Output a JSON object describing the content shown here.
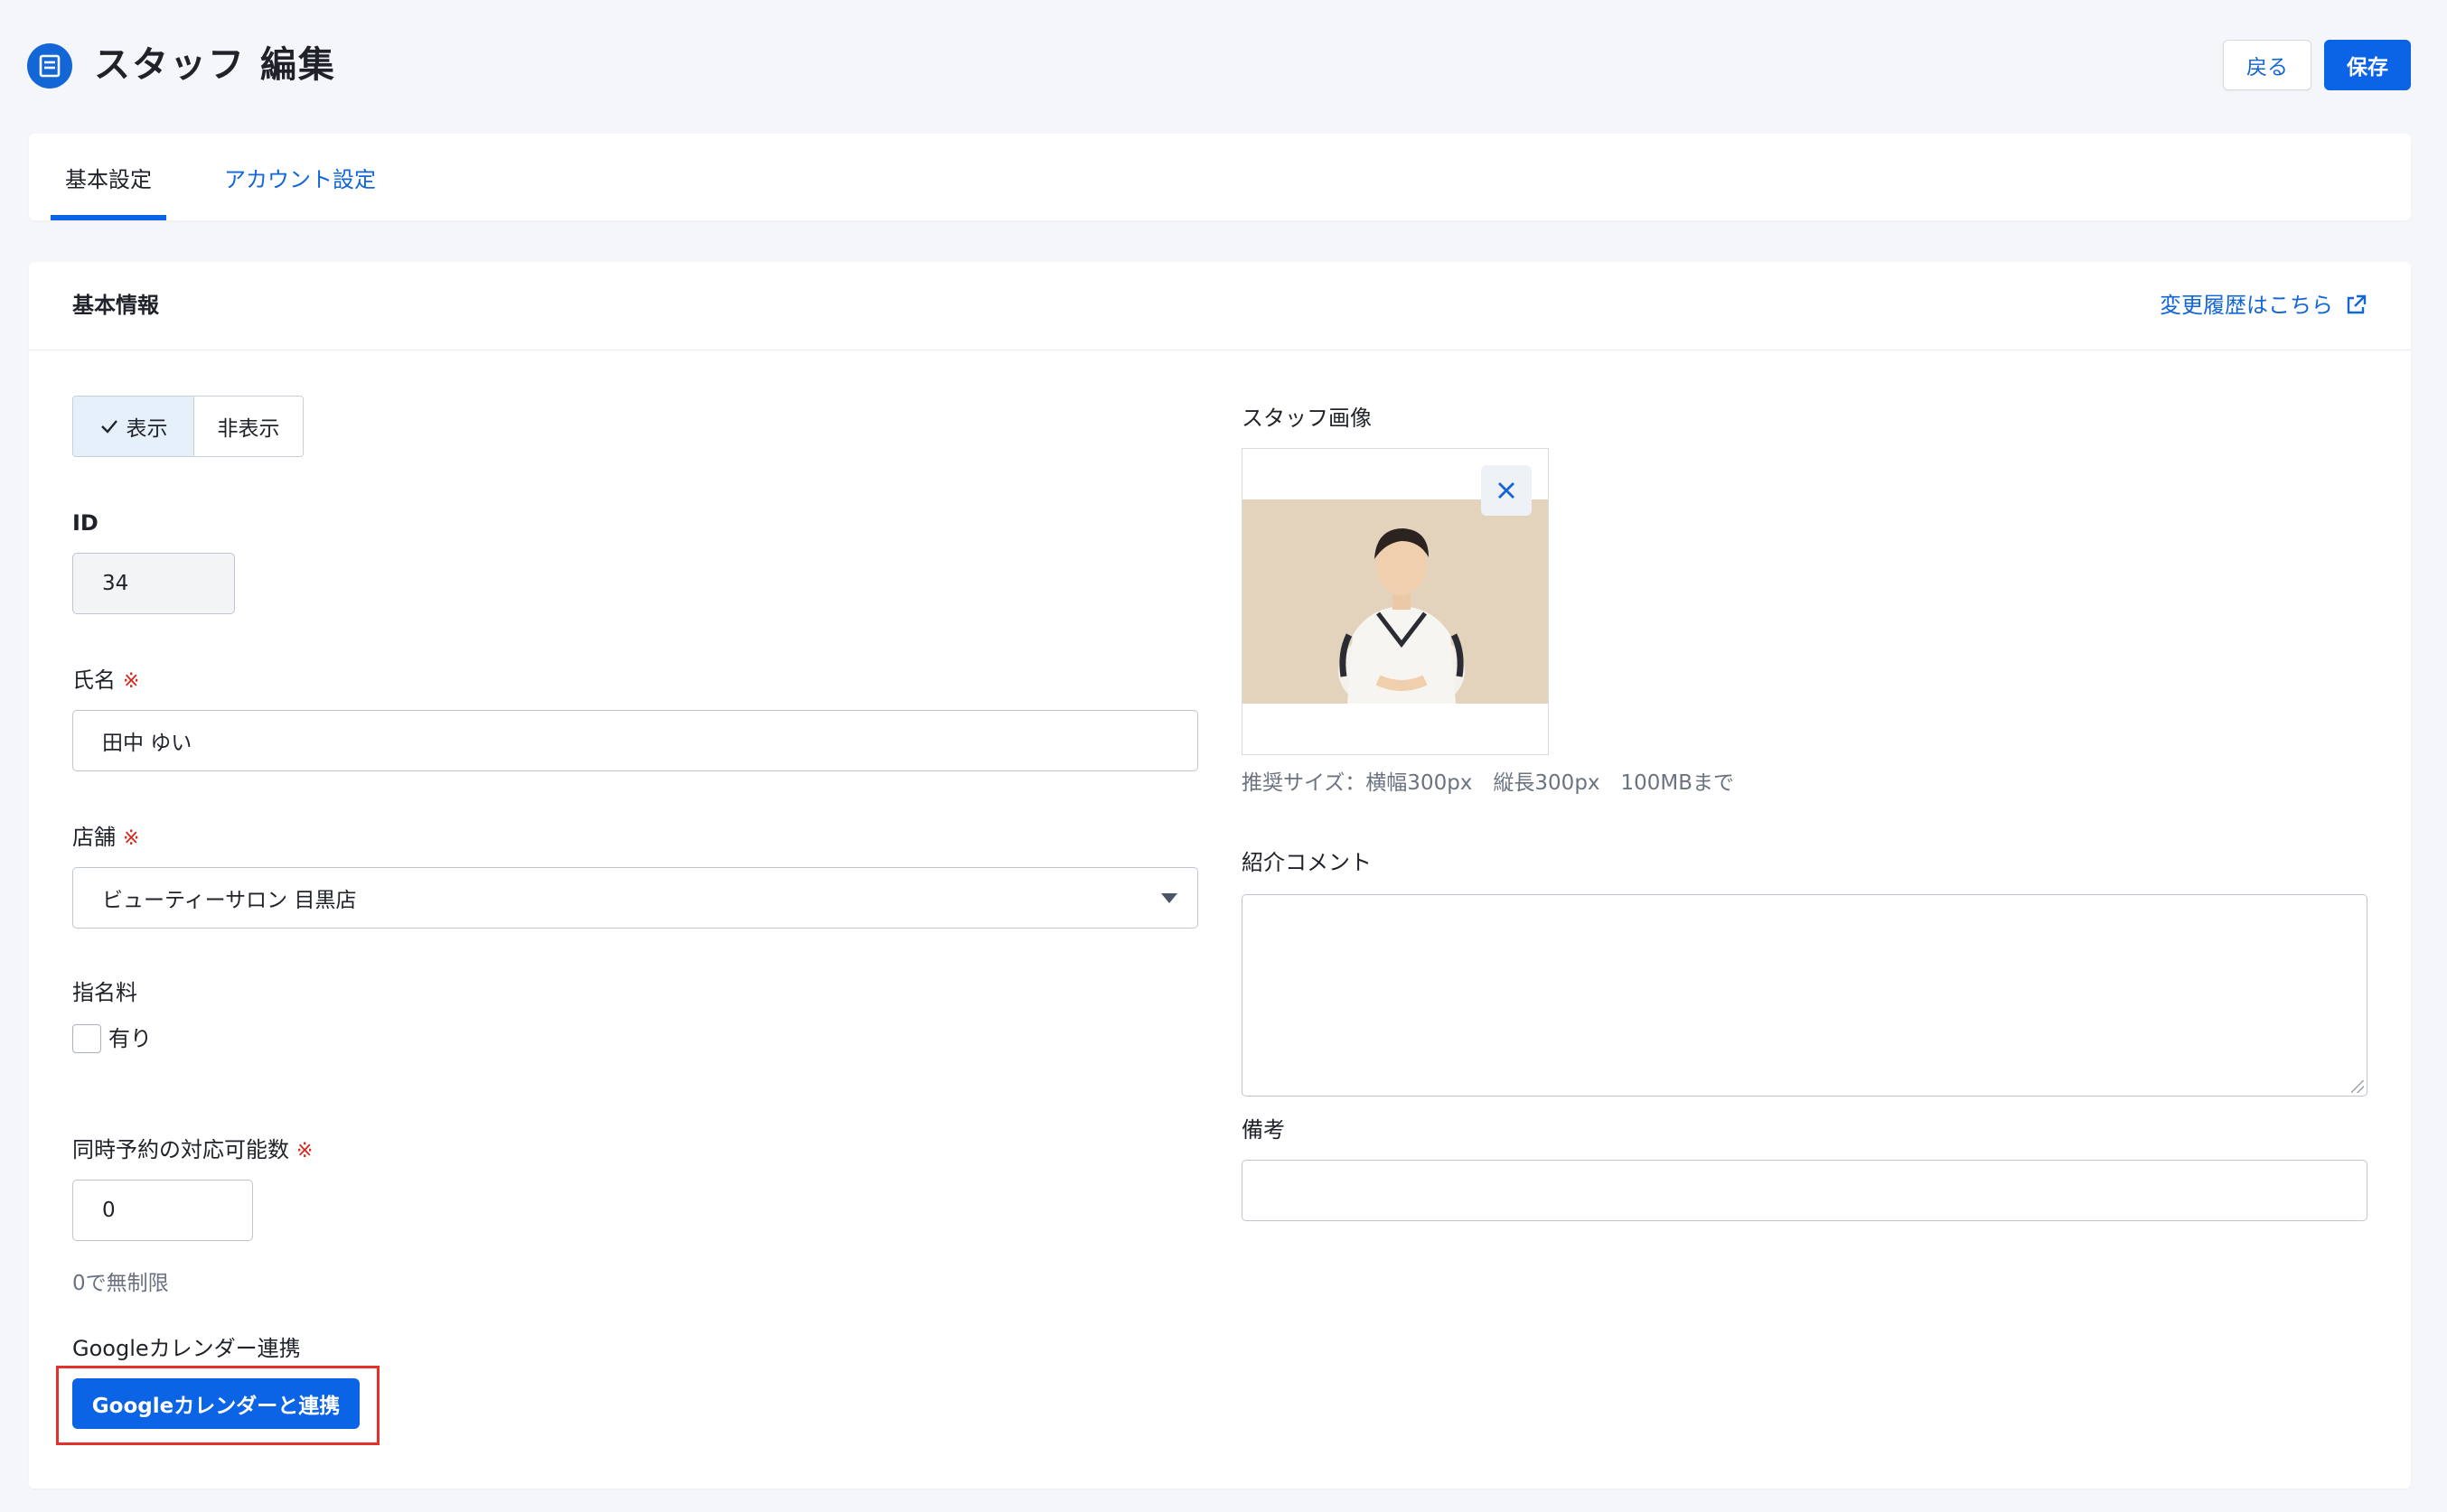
{
  "header": {
    "title": "スタッフ 編集",
    "back_label": "戻る",
    "save_label": "保存"
  },
  "tabs": [
    {
      "label": "基本設定",
      "active": true
    },
    {
      "label": "アカウント設定",
      "active": false
    }
  ],
  "card": {
    "title": "基本情報",
    "history_link": "変更履歴はこちら"
  },
  "visibility": {
    "options": [
      "表示",
      "非表示"
    ],
    "selected": "表示"
  },
  "fields": {
    "id": {
      "label": "ID",
      "value": "34"
    },
    "name": {
      "label": "氏名",
      "required_mark": "※",
      "value": "田中 ゆい"
    },
    "store": {
      "label": "店舗",
      "required_mark": "※",
      "value": "ビューティーサロン 目黒店"
    },
    "nomination_fee": {
      "label": "指名料",
      "checkbox_label": "有り",
      "checked": false
    },
    "concurrent": {
      "label": "同時予約の対応可能数",
      "required_mark": "※",
      "value": "0",
      "hint": "0で無制限"
    },
    "google": {
      "label": "Googleカレンダー連携",
      "button_label": "Googleカレンダーと連携"
    },
    "staff_image": {
      "label": "スタッフ画像",
      "hint": "推奨サイズ：横幅300px　縦長300px　100MBまで"
    },
    "intro": {
      "label": "紹介コメント",
      "value": ""
    },
    "notes": {
      "label": "備考",
      "value": ""
    }
  },
  "colors": {
    "primary": "#0b63e5",
    "link": "#1366d6",
    "required": "#d6271d",
    "highlight": "#e2302a"
  }
}
